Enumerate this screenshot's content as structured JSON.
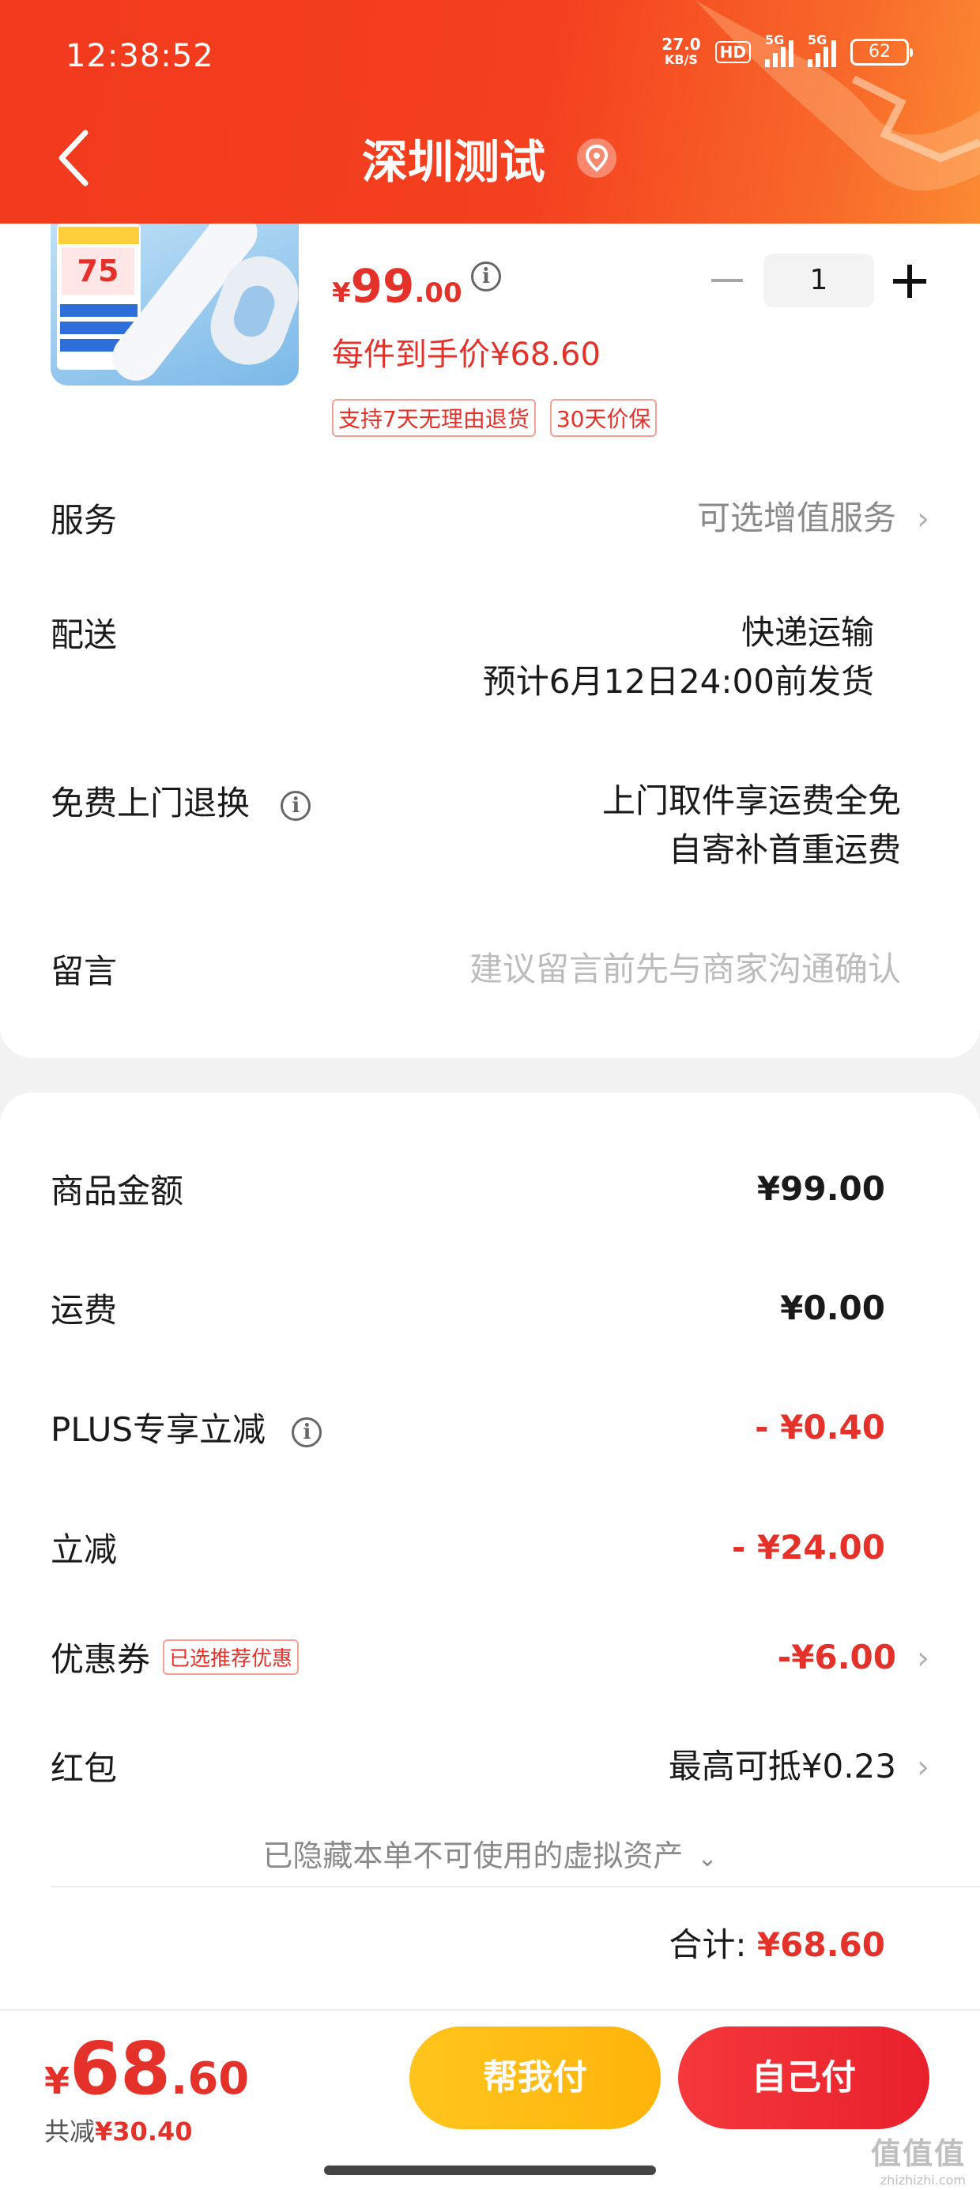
{
  "status_bar": {
    "time": "12:38:52",
    "net_speed_value": "27.0",
    "net_speed_unit": "KB/S",
    "hd_label": "HD",
    "sim1_label": "5G",
    "sim2_label": "5G",
    "battery": "62"
  },
  "header": {
    "title": "深圳测试",
    "back_icon": "chevron-left-icon",
    "location_icon": "location-pin-icon"
  },
  "product": {
    "thumb_promo": "75",
    "price_currency": "¥",
    "price_int": "99",
    "price_dec": ".00",
    "quantity": "1",
    "net_price": "每件到手价¥68.60",
    "tags": [
      "支持7天无理由退货",
      "30天价保"
    ]
  },
  "order_rows": {
    "service_label": "服务",
    "service_value": "可选增值服务",
    "delivery_label": "配送",
    "delivery_method": "快递运输",
    "delivery_eta": "预计6月12日24:00前发货",
    "return_label": "免费上门退换",
    "return_line1": "上门取件享运费全免",
    "return_line2": "自寄补首重运费",
    "message_label": "留言",
    "message_placeholder": "建议留言前先与商家沟通确认"
  },
  "summary": {
    "goods_label": "商品金额",
    "goods_value": "¥99.00",
    "shipping_label": "运费",
    "shipping_value": "¥0.00",
    "plus_label": "PLUS专享立减",
    "plus_value": "- ¥0.40",
    "instant_label": "立减",
    "instant_value": "- ¥24.00",
    "coupon_label": "优惠券",
    "coupon_tag": "已选推荐优惠",
    "coupon_value": "-¥6.00",
    "redpacket_label": "红包",
    "redpacket_value": "最高可抵¥0.23",
    "hidden_assets": "已隐藏本单不可使用的虚拟资产",
    "total_label": "合计:",
    "total_value": "¥68.60"
  },
  "bottom_bar": {
    "price_currency": "¥",
    "price_int": "68",
    "price_dec": ".60",
    "saved_label": "共减",
    "saved_value": "¥30.40",
    "friend_pay_label": "帮我付",
    "self_pay_label": "自己付",
    "watermark": "值值值",
    "watermark_url": "zhizhizhi.com"
  },
  "colors": {
    "accent_red": "#e4322b",
    "header_orange": "#f4401f",
    "friend_button": "#ffb40a",
    "self_button": "#e8202c"
  }
}
